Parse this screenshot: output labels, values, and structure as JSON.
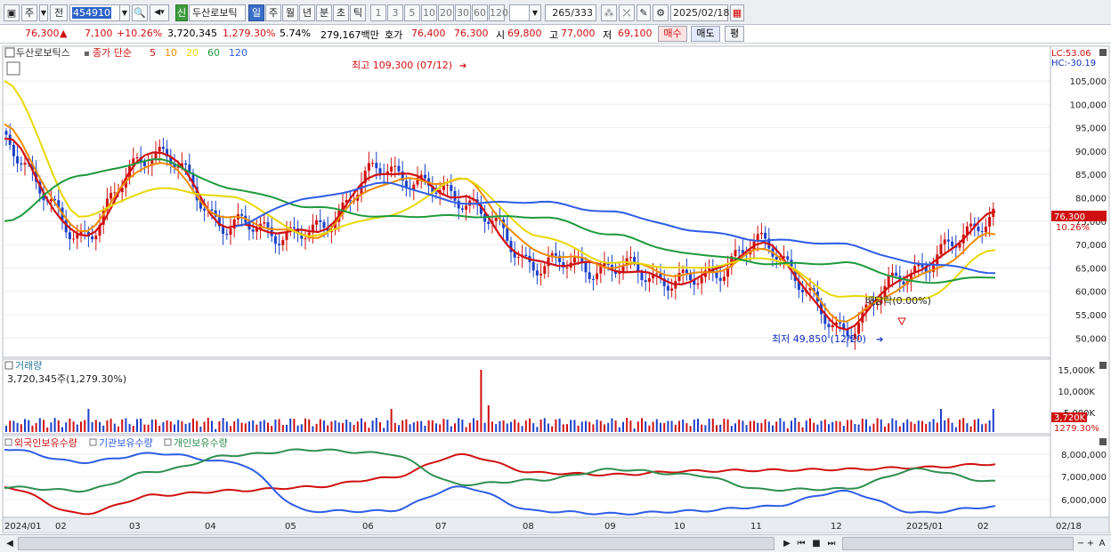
{
  "toolbar": {
    "period_main": "주",
    "prev_label": "전",
    "code": "454910",
    "new_badge": "신",
    "stock_name": "두산로보틱",
    "periods": [
      "일",
      "주",
      "월",
      "년",
      "분",
      "초",
      "틱"
    ],
    "selected_period": "일",
    "intervals": [
      "1",
      "3",
      "5",
      "10",
      "20",
      "30",
      "60",
      "120"
    ],
    "count": "265",
    "total": "/333",
    "date": "2025/02/18"
  },
  "info": {
    "price": "76,300",
    "arrow": "▲",
    "change": "7,100",
    "change_pct": "+10.26%",
    "volume": "3,720,345",
    "volume_pct": "1,279.30%",
    "turnover": "5.74%",
    "amount": "279,167백만",
    "hoga_label": "호가",
    "ask": "76,400",
    "bid": "76,300",
    "open_label": "시",
    "open": "69,800",
    "high_label": "고",
    "high": "77,000",
    "low_label": "저",
    "low": "69,100",
    "buy_btn": "매수",
    "sell_btn": "매도",
    "eval_btn": "평"
  },
  "legend": {
    "name": "두산로보틱스",
    "price_type": "종가 단순",
    "ma_periods": [
      "5",
      "10",
      "20",
      "60",
      "120"
    ],
    "ma_colors": [
      "#d01010",
      "#f08c00",
      "#e8d800",
      "#1e9a3c",
      "#2e5ce6"
    ]
  },
  "labels": {
    "lc": "LC:53.06",
    "hc": "HC:-30.19",
    "high_note": "최고 109,300 (07/12)",
    "low_note": "최저 49,850 (12/20)",
    "dividend_note": "배당락(0.00%)",
    "current_price_tag": "76,300",
    "current_pct_tag": "10.26%",
    "volume_title": "거래량",
    "volume_info": "3,720,345주(1,279.30%)",
    "volume_tag": "3,720K",
    "volume_pct_tag": "1279.30%",
    "holding_legends": [
      "외국인보유수량",
      "기관보유수량",
      "개인보유수량"
    ],
    "holding_colors": [
      "#d01010",
      "#2e5ce6",
      "#2f8f4f"
    ]
  },
  "axes": {
    "price_ticks": [
      "105,000",
      "100,000",
      "95,000",
      "90,000",
      "85,000",
      "80,000",
      "75,000",
      "70,000",
      "65,000",
      "60,000",
      "55,000",
      "50,000"
    ],
    "volume_ticks": [
      "15,000K",
      "10,000K",
      "5,000K"
    ],
    "holding_ticks": [
      "8,000,000",
      "7,000,000",
      "6,000,000"
    ],
    "x_labels": [
      "2024/01",
      "02",
      "03",
      "04",
      "05",
      "06",
      "07",
      "08",
      "09",
      "10",
      "11",
      "12",
      "2025/01",
      "02",
      "02/18"
    ]
  },
  "chart_data": {
    "type": "line",
    "title": "두산로보틱스",
    "x": [
      "2024/01",
      "02",
      "03",
      "04",
      "05",
      "06",
      "07",
      "08",
      "09",
      "10",
      "11",
      "12",
      "2025/01",
      "02"
    ],
    "ylim": [
      48000,
      110000
    ],
    "series": [
      {
        "name": "5",
        "values": [
          92000,
          72000,
          90000,
          74000,
          72000,
          86000,
          80000,
          66000,
          65000,
          62000,
          70000,
          52000,
          65000,
          76000
        ]
      },
      {
        "name": "10",
        "values": [
          95000,
          73000,
          88000,
          75000,
          72000,
          83000,
          84000,
          68000,
          66000,
          63000,
          69000,
          54000,
          63000,
          72000
        ]
      },
      {
        "name": "20",
        "values": [
          105000,
          76000,
          82000,
          80000,
          72000,
          76000,
          84000,
          72000,
          66000,
          65000,
          67000,
          59000,
          58000,
          69000
        ]
      },
      {
        "name": "60",
        "values": [
          75000,
          85000,
          88000,
          82000,
          78000,
          76000,
          76000,
          76000,
          72000,
          68000,
          66000,
          66000,
          62000,
          63000
        ]
      },
      {
        "name": "120",
        "values": [
          null,
          null,
          null,
          74000,
          80000,
          83000,
          79000,
          79000,
          77000,
          73000,
          71000,
          70000,
          66000,
          64000
        ]
      }
    ]
  }
}
